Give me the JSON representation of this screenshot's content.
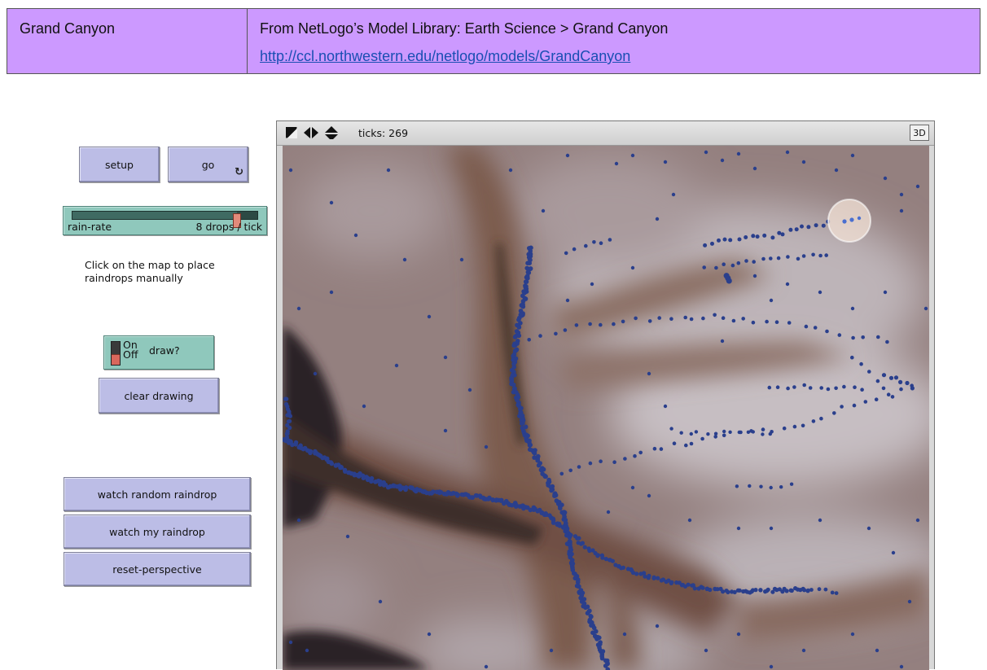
{
  "header": {
    "model_name": "Grand Canyon",
    "source_text": "From NetLogo’s Model Library: Earth Science > Grand Canyon",
    "url": "http://ccl.northwestern.edu/netlogo/models/GrandCanyon"
  },
  "buttons": {
    "setup": "setup",
    "go": "go",
    "clear_drawing": "clear drawing",
    "watch_random": "watch random raindrop",
    "watch_mine": "watch my raindrop",
    "reset_perspective": "reset-perspective"
  },
  "slider": {
    "label": "rain-rate",
    "value_text": "8 drops / tick",
    "value": 8,
    "min": 0,
    "max": 9
  },
  "note": {
    "line1": "Click on the map to place",
    "line2": "raindrops manually"
  },
  "switch": {
    "name": "draw?",
    "on_label": "On",
    "off_label": "Off",
    "state": "off"
  },
  "view": {
    "ticks_label": "ticks: 269",
    "button_3d": "3D"
  },
  "colors": {
    "header_bg": "#cc99ff",
    "button_bg": "#bcbde6",
    "widget_bg": "#8fc8bc",
    "raindrop": "#2a3f8c"
  },
  "icons": [
    "stretch-icon",
    "arrows-horizontal-icon",
    "arrows-vertical-icon",
    "forever-icon"
  ]
}
